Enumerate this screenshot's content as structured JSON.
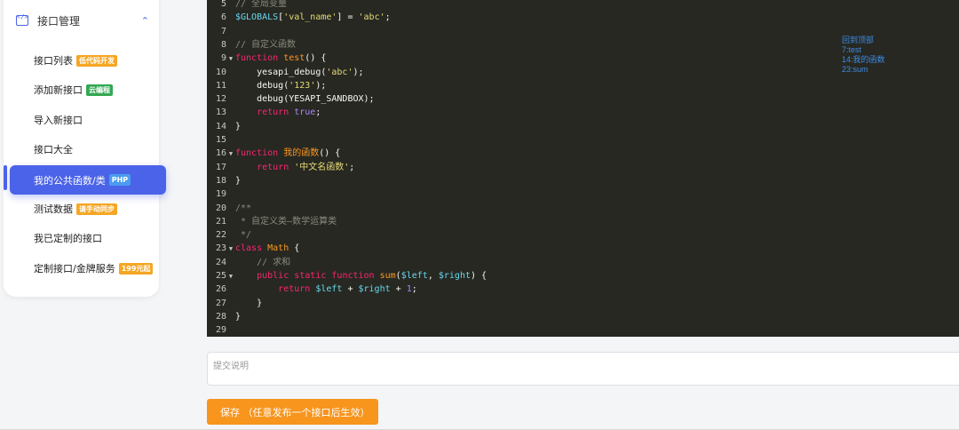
{
  "sidebar": {
    "group_label": "接口管理",
    "items": [
      {
        "label": "接口列表",
        "badge": "低代码开发",
        "badge_color": "#f5a623"
      },
      {
        "label": "添加新接口",
        "badge": "云编程",
        "badge_color": "#33a852"
      },
      {
        "label": "导入新接口",
        "badge": ""
      },
      {
        "label": "接口大全",
        "badge": ""
      },
      {
        "label": "我的公共函数/类",
        "badge": "PHP",
        "badge_color": "#4b9cf0",
        "active": true
      },
      {
        "label": "测试数据",
        "badge": "请手动同步",
        "badge_color": "#f5a623"
      },
      {
        "label": "我已定制的接口",
        "badge": ""
      },
      {
        "label": "定制接口/金牌服务",
        "badge": "199元起",
        "badge_color": "#f5a623"
      }
    ]
  },
  "editor": {
    "lines": [
      {
        "n": "5",
        "fold": false,
        "text": "// 全局变量"
      },
      {
        "n": "6",
        "fold": false,
        "text": "$GLOBALS['val_name'] = 'abc';"
      },
      {
        "n": "7",
        "fold": false,
        "text": ""
      },
      {
        "n": "8",
        "fold": false,
        "text": "// 自定义函数"
      },
      {
        "n": "9",
        "fold": true,
        "text": "function test() {"
      },
      {
        "n": "10",
        "fold": false,
        "text": "    yesapi_debug('abc');"
      },
      {
        "n": "11",
        "fold": false,
        "text": "    debug('123');"
      },
      {
        "n": "12",
        "fold": false,
        "text": "    debug(YESAPI_SANDBOX);"
      },
      {
        "n": "13",
        "fold": false,
        "text": "    return true;"
      },
      {
        "n": "14",
        "fold": false,
        "text": "}"
      },
      {
        "n": "15",
        "fold": false,
        "text": ""
      },
      {
        "n": "16",
        "fold": true,
        "text": "function 我的函数() {"
      },
      {
        "n": "17",
        "fold": false,
        "text": "    return '中文名函数';"
      },
      {
        "n": "18",
        "fold": false,
        "text": "}"
      },
      {
        "n": "19",
        "fold": false,
        "text": ""
      },
      {
        "n": "20",
        "fold": false,
        "text": "/**"
      },
      {
        "n": "21",
        "fold": false,
        "text": " * 自定义类—数学运算类"
      },
      {
        "n": "22",
        "fold": false,
        "text": " */"
      },
      {
        "n": "23",
        "fold": true,
        "text": "class Math {"
      },
      {
        "n": "24",
        "fold": false,
        "text": "    // 求和"
      },
      {
        "n": "25",
        "fold": true,
        "text": "    public static function sum($left, $right) {"
      },
      {
        "n": "26",
        "fold": false,
        "text": "        return $left + $right + 1;"
      },
      {
        "n": "27",
        "fold": false,
        "text": "    }"
      },
      {
        "n": "28",
        "fold": false,
        "text": "}"
      },
      {
        "n": "29",
        "fold": false,
        "text": ""
      }
    ],
    "outline": [
      "回到顶部",
      "7:test",
      "14:我的函数",
      "23:sum"
    ]
  },
  "commit": {
    "placeholder": "提交说明"
  },
  "save_label": "保存 （任意发布一个接口后生效）",
  "colors": {
    "accent": "#4b63e8",
    "save": "#f7951d",
    "editor_bg": "#272822"
  }
}
